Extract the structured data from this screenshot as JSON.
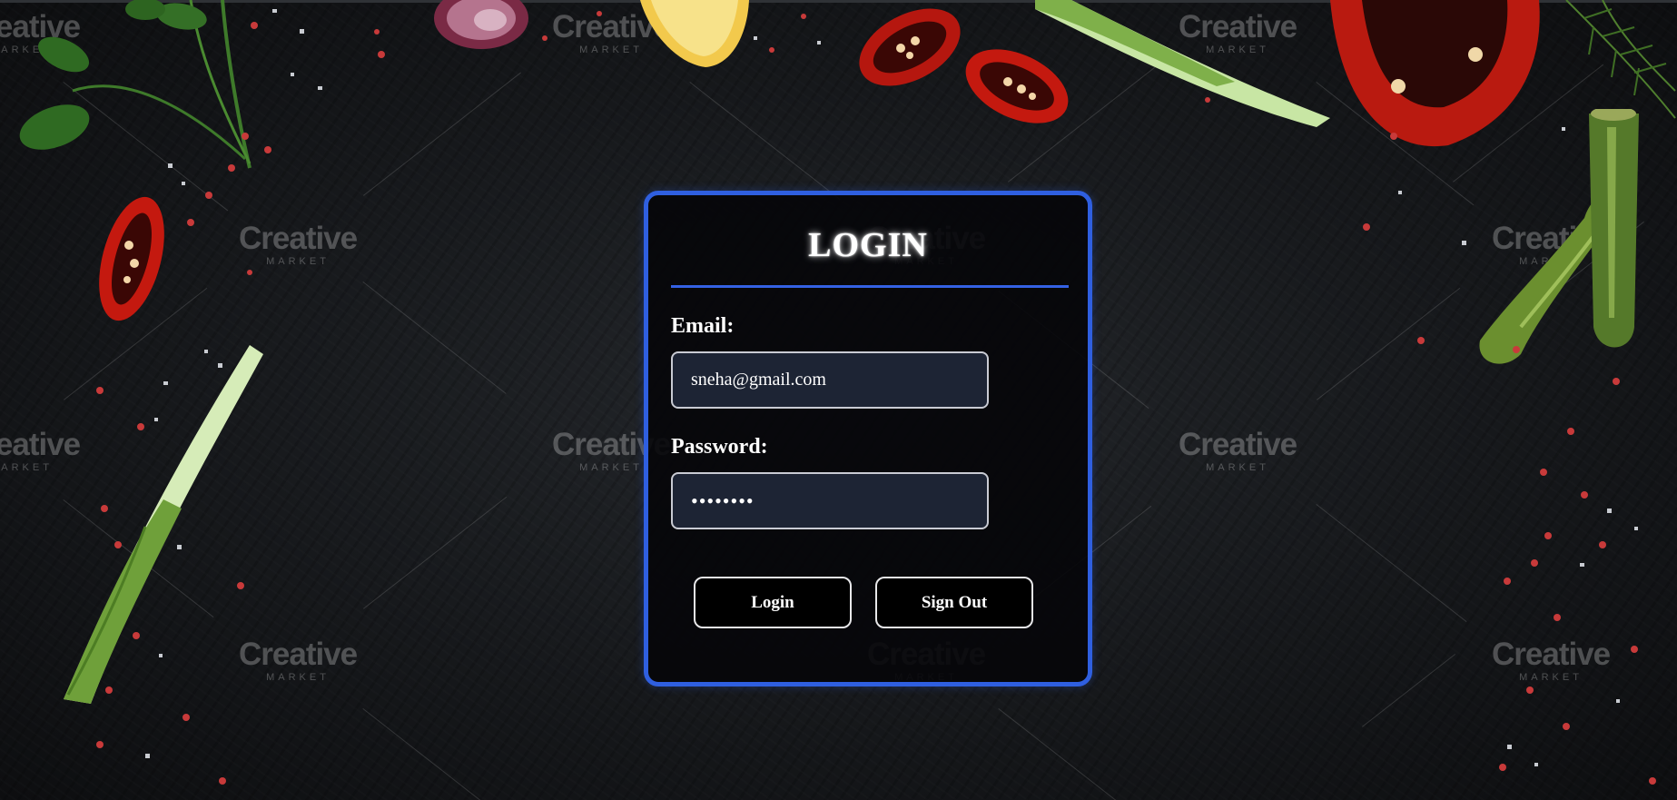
{
  "login_card": {
    "title": "LOGIN",
    "email_label": "Email:",
    "email_value": "sneha@gmail.com",
    "password_label": "Password:",
    "password_value": "12345678",
    "login_button": "Login",
    "signout_button": "Sign Out"
  },
  "background": {
    "watermark_title": "Creative",
    "watermark_subtitle": "MARKET"
  },
  "colors": {
    "accent": "#2f5fe0",
    "card_background": "#050609",
    "input_background": "#1d2434",
    "page_background": "#16181b"
  }
}
